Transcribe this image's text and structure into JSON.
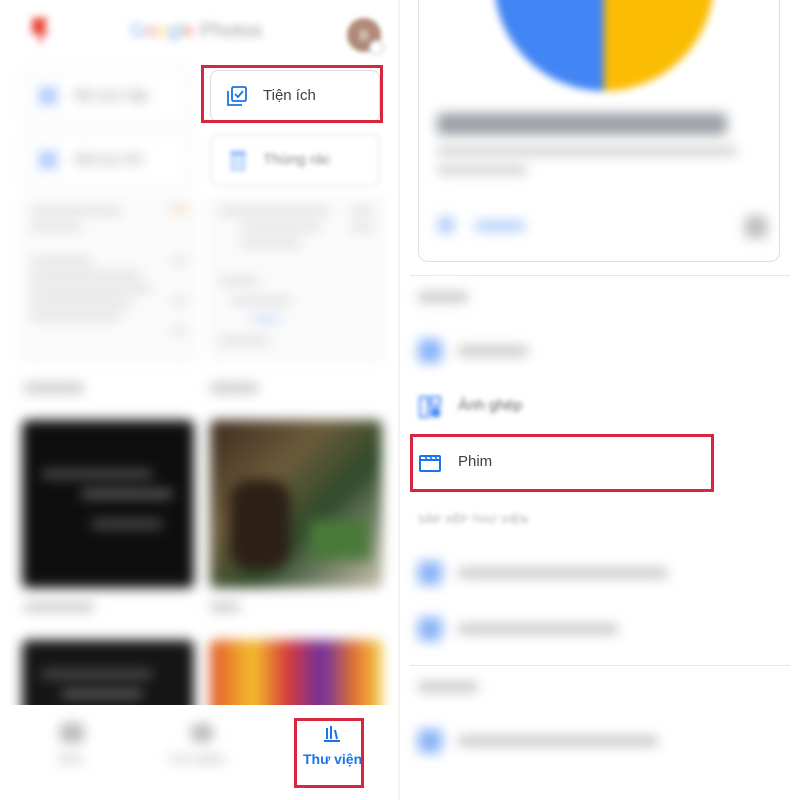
{
  "left": {
    "app_logo": {
      "word_brand": "Google",
      "word_product": "Photos"
    },
    "avatar": {
      "initial": "B"
    },
    "utilities": [
      {
        "name": "blurred-item-1",
        "label": "Bộ sưu tập"
      },
      {
        "name": "tien-ich",
        "label": "Tiện ích"
      },
      {
        "name": "blurred-item-2",
        "label": "Đã lưu trữ"
      },
      {
        "name": "thung-rac",
        "label": "Thùng rác"
      }
    ],
    "albums": [
      {
        "caption": ""
      },
      {
        "caption": ""
      },
      {
        "caption": ""
      },
      {
        "caption": ""
      }
    ],
    "bottom_nav": {
      "items": [
        {
          "label": "Ảnh"
        },
        {
          "label": "Tìm kiếm"
        },
        {
          "label": "Thư viện"
        }
      ],
      "active": "Thư viện"
    }
  },
  "right": {
    "hero_card": {
      "title": "",
      "subtitle": ""
    },
    "create_section": {
      "items": [
        {
          "label": "Ảnh ghép",
          "icon": "collage-icon"
        },
        {
          "label": "Phim",
          "icon": "movie-icon"
        }
      ]
    },
    "organize_section": {
      "header": "SẮP XẾP THƯ VIỆN"
    }
  },
  "colors": {
    "accent_blue": "#1a73e8",
    "highlight_red": "#d7263d",
    "google_blue": "#4285f4",
    "google_yellow": "#fbbc04"
  }
}
